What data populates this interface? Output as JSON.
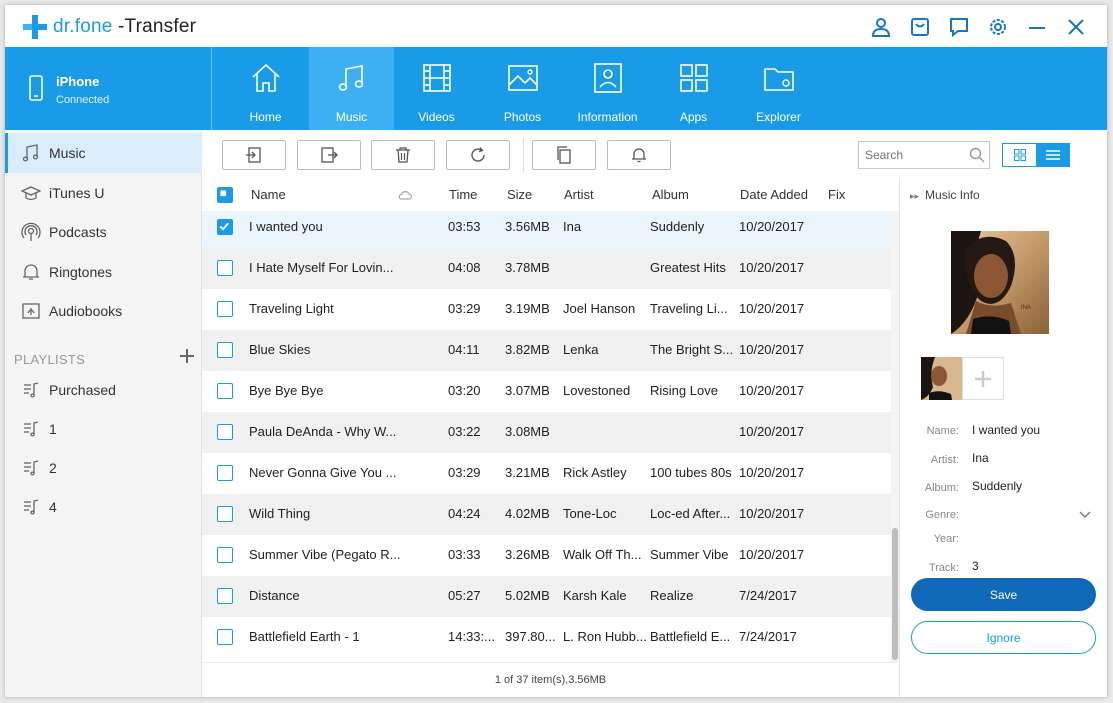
{
  "app": {
    "brand": "dr.fone",
    "suffix": " -Transfer"
  },
  "device": {
    "name": "iPhone",
    "status": "Connected"
  },
  "nav": [
    {
      "label": "Home"
    },
    {
      "label": "Music"
    },
    {
      "label": "Videos"
    },
    {
      "label": "Photos"
    },
    {
      "label": "Information"
    },
    {
      "label": "Apps"
    },
    {
      "label": "Explorer"
    }
  ],
  "sidebar": {
    "items": [
      {
        "label": "Music"
      },
      {
        "label": "iTunes U"
      },
      {
        "label": "Podcasts"
      },
      {
        "label": "Ringtones"
      },
      {
        "label": "Audiobooks"
      }
    ],
    "playlists_header": "PLAYLISTS",
    "playlists": [
      {
        "label": "Purchased"
      },
      {
        "label": "1"
      },
      {
        "label": "2"
      },
      {
        "label": "4"
      }
    ]
  },
  "search": {
    "placeholder": "Search"
  },
  "table": {
    "headers": {
      "name": "Name",
      "time": "Time",
      "size": "Size",
      "artist": "Artist",
      "album": "Album",
      "date": "Date Added",
      "fix": "Fix"
    },
    "rows": [
      {
        "name": "I wanted you",
        "time": "03:53",
        "size": "3.56MB",
        "artist": "Ina",
        "album": "Suddenly",
        "date": "10/20/2017"
      },
      {
        "name": "I Hate Myself For Lovin...",
        "time": "04:08",
        "size": "3.78MB",
        "artist": "",
        "album": "Greatest Hits",
        "date": "10/20/2017"
      },
      {
        "name": "Traveling Light",
        "time": "03:29",
        "size": "3.19MB",
        "artist": "Joel Hanson",
        "album": "Traveling Li...",
        "date": "10/20/2017"
      },
      {
        "name": "Blue Skies",
        "time": "04:11",
        "size": "3.82MB",
        "artist": "Lenka",
        "album": "The Bright S...",
        "date": "10/20/2017"
      },
      {
        "name": "Bye Bye Bye",
        "time": "03:20",
        "size": "3.07MB",
        "artist": "Lovestoned",
        "album": "Rising Love",
        "date": "10/20/2017"
      },
      {
        "name": "Paula DeAnda - Why W...",
        "time": "03:22",
        "size": "3.08MB",
        "artist": "",
        "album": "",
        "date": "10/20/2017"
      },
      {
        "name": "Never Gonna Give You ...",
        "time": "03:29",
        "size": "3.21MB",
        "artist": "Rick Astley",
        "album": "100 tubes 80s",
        "date": "10/20/2017"
      },
      {
        "name": "Wild Thing",
        "time": "04:24",
        "size": "4.02MB",
        "artist": "Tone-Loc",
        "album": "Loc-ed After...",
        "date": "10/20/2017"
      },
      {
        "name": "Summer Vibe (Pegato R...",
        "time": "03:33",
        "size": "3.26MB",
        "artist": "Walk Off Th...",
        "album": "Summer Vibe",
        "date": "10/20/2017"
      },
      {
        "name": "Distance",
        "time": "05:27",
        "size": "5.02MB",
        "artist": "Karsh Kale",
        "album": "Realize",
        "date": "7/24/2017"
      },
      {
        "name": "Battlefield Earth - 1",
        "time": "14:33:...",
        "size": "397.80...",
        "artist": "L. Ron Hubb...",
        "album": "Battlefield E...",
        "date": "7/24/2017"
      }
    ]
  },
  "status_text": "1 of 37 item(s),3.56MB",
  "info": {
    "header": "Music Info",
    "fields": {
      "name_label": "Name:",
      "name_value": "I wanted you",
      "artist_label": "Artist:",
      "artist_value": "Ina",
      "album_label": "Album:",
      "album_value": "Suddenly",
      "genre_label": "Genre:",
      "year_label": "Year:",
      "track_label": "Track:",
      "track_value": "3"
    },
    "save_label": "Save",
    "ignore_label": "Ignore"
  },
  "colors": {
    "accent": "#1a9be8",
    "accent_dark": "#0f69b8",
    "nav_active": "#3cb0f3"
  }
}
